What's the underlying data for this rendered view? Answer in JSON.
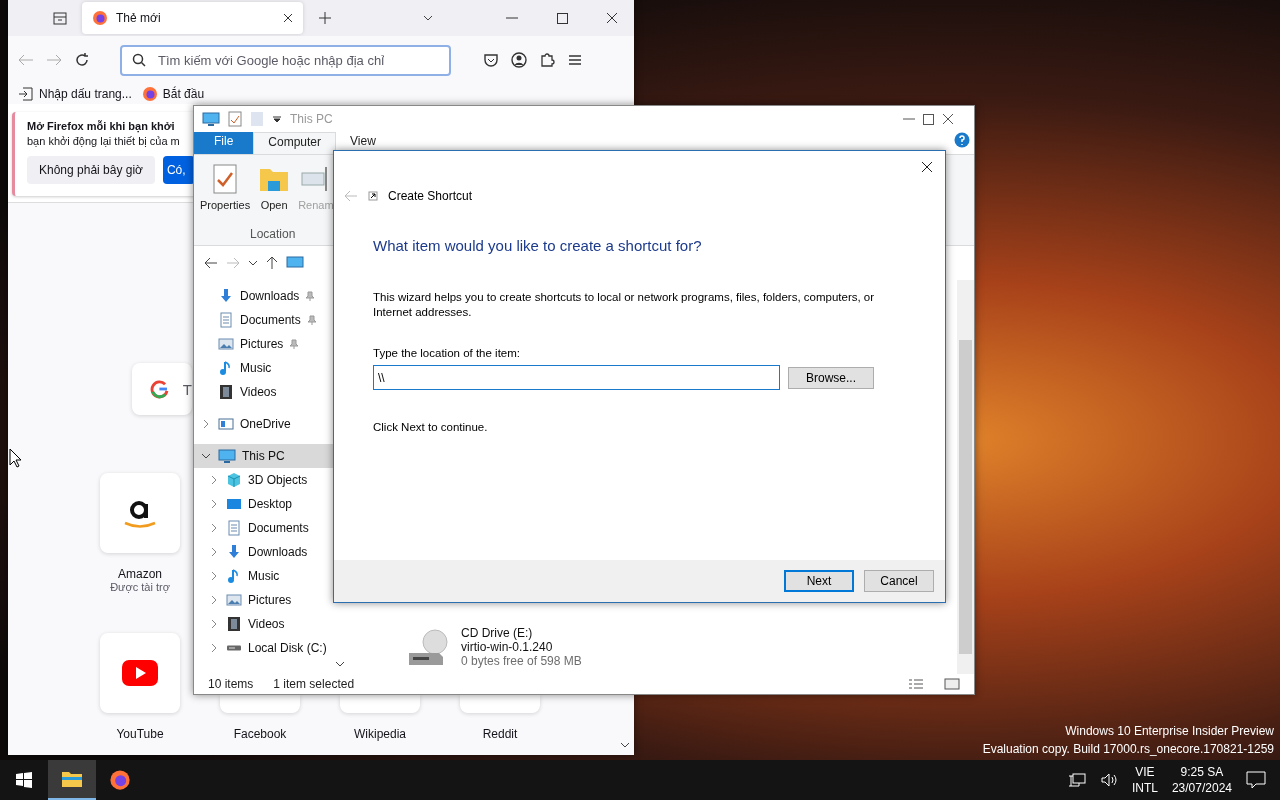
{
  "firefox": {
    "tabs": [
      {
        "label": "Thẻ mới",
        "selected": true
      }
    ],
    "address": {
      "placeholder": "Tìm kiếm với Google hoặc nhập địa chỉ"
    },
    "bookmarks": [
      {
        "label": "Nhập dấu trang...",
        "kind": "import"
      },
      {
        "label": "Bắt đầu",
        "kind": "firefox"
      }
    ],
    "notice": {
      "title": "Mở Firefox mỗi khi bạn khởi",
      "text": "bạn khởi động lại thiết bị của m",
      "buttons": [
        {
          "label": "Không phải bây giờ",
          "primary": false
        },
        {
          "label": "Có,",
          "primary": true
        }
      ]
    },
    "search_box": {
      "placeholder": "T"
    },
    "shortcuts": [
      {
        "label": "Amazon",
        "sublabel": "Được tài trợ",
        "kind": "amazon"
      },
      {
        "label": "YouTube",
        "kind": "youtube"
      },
      {
        "label": "Facebook",
        "kind": "blank"
      },
      {
        "label": "Wikipedia",
        "kind": "blank"
      },
      {
        "label": "Reddit",
        "kind": "blank"
      }
    ]
  },
  "explorer": {
    "title": "This PC",
    "ribbon_tabs": [
      {
        "label": "File",
        "kind": "file",
        "selected": false
      },
      {
        "label": "Computer",
        "kind": "tab",
        "selected": true
      },
      {
        "label": "View",
        "kind": "tab",
        "selected": false
      }
    ],
    "ribbon_buttons": [
      {
        "label": "Properties",
        "kind": "properties",
        "disabled": false
      },
      {
        "label": "Open",
        "kind": "folder",
        "disabled": false
      },
      {
        "label": "Renam",
        "kind": "rename",
        "disabled": true
      }
    ],
    "ribbon_group": "Location",
    "nav_tree": [
      {
        "label": "Downloads",
        "kind": "download",
        "pinned": true,
        "selected": false
      },
      {
        "label": "Documents",
        "kind": "document",
        "pinned": true,
        "selected": false
      },
      {
        "label": "Pictures",
        "kind": "picture",
        "pinned": true,
        "selected": false
      },
      {
        "label": "Music",
        "kind": "music",
        "pinned": false,
        "selected": false
      },
      {
        "label": "Videos",
        "kind": "video",
        "pinned": false,
        "selected": false
      },
      {
        "label": "OneDrive",
        "kind": "cloud",
        "pinned": false,
        "selected": false,
        "expanded": false
      },
      {
        "label": "This PC",
        "kind": "pc",
        "pinned": false,
        "selected": true,
        "expanded": true,
        "children": [
          {
            "label": "3D Objects",
            "kind": "cube",
            "selected": false,
            "expanded": false
          },
          {
            "label": "Desktop",
            "kind": "desktop",
            "selected": false,
            "expanded": false
          },
          {
            "label": "Documents",
            "kind": "document",
            "selected": false,
            "expanded": false
          },
          {
            "label": "Downloads",
            "kind": "download",
            "selected": false,
            "expanded": false
          },
          {
            "label": "Music",
            "kind": "music",
            "selected": false,
            "expanded": false
          },
          {
            "label": "Pictures",
            "kind": "picture",
            "selected": false,
            "expanded": false
          },
          {
            "label": "Videos",
            "kind": "video",
            "selected": false,
            "expanded": false
          },
          {
            "label": "Local Disk (C:)",
            "kind": "disk",
            "selected": false,
            "expanded": false
          }
        ]
      }
    ],
    "drive": {
      "name": "CD Drive (E:)",
      "volume": "virtio-win-0.1.240",
      "space": "0 bytes free of 598 MB"
    },
    "status": {
      "count": "10 items",
      "selection": "1 item selected"
    }
  },
  "dialog": {
    "title": "Create Shortcut",
    "heading": "What item would you like to create a shortcut for?",
    "description": "This wizard helps you to create shortcuts to local or network programs, files, folders, computers, or Internet addresses.",
    "field_label": "Type the location of the item:",
    "location": "\\\\",
    "browse": "Browse...",
    "hint": "Click Next to continue.",
    "buttons": [
      {
        "label": "Next",
        "default": true
      },
      {
        "label": "Cancel",
        "default": false
      }
    ]
  },
  "desktop": {
    "edition": "Windows 10 Enterprise Insider Preview",
    "build": "Evaluation copy. Build 17000.rs_onecore.170821-1259"
  },
  "taskbar": {
    "apps": [
      {
        "kind": "explorer",
        "active": true
      },
      {
        "kind": "firefox",
        "active": false
      }
    ],
    "language": "VIE",
    "layout": "INTL",
    "time": "9:25 SA",
    "date": "23/07/2024"
  }
}
